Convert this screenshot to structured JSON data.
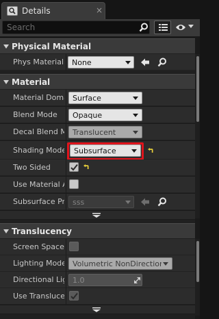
{
  "tab": {
    "title": "Details",
    "close_glyph": "×",
    "icon": "details-icon"
  },
  "search": {
    "placeholder": "Search",
    "value": ""
  },
  "sections": {
    "physical_material": {
      "title": "Physical Material",
      "rows": [
        {
          "label": "Phys Material",
          "value": "None"
        }
      ]
    },
    "material": {
      "title": "Material",
      "rows": [
        {
          "label": "Material Domain",
          "value": "Surface"
        },
        {
          "label": "Blend Mode",
          "value": "Opaque"
        },
        {
          "label": "Decal Blend Mode",
          "value": "Translucent"
        },
        {
          "label": "Shading Model",
          "value": "Subsurface"
        },
        {
          "label": "Two Sided",
          "checked": true
        },
        {
          "label": "Use Material Attributes",
          "checked": false
        },
        {
          "label": "Subsurface Profile",
          "value": "sss"
        }
      ]
    },
    "translucency": {
      "title": "Translucency",
      "rows": [
        {
          "label": "Screen Space Reflections",
          "checked": false
        },
        {
          "label": "Lighting Mode",
          "value": "Volumetric NonDirectional"
        },
        {
          "label": "Directional Lighting Intensity",
          "value": "1.0"
        },
        {
          "label": "Use Translucency Vertex Fog",
          "checked": true
        }
      ]
    }
  },
  "colors": {
    "header_bg": "#3a3a3a",
    "row_bg": "#2c2c2c",
    "combo_bg": "#e5e5e5",
    "highlight": "#e0141c",
    "reset_arrow": "#e8d03a"
  }
}
